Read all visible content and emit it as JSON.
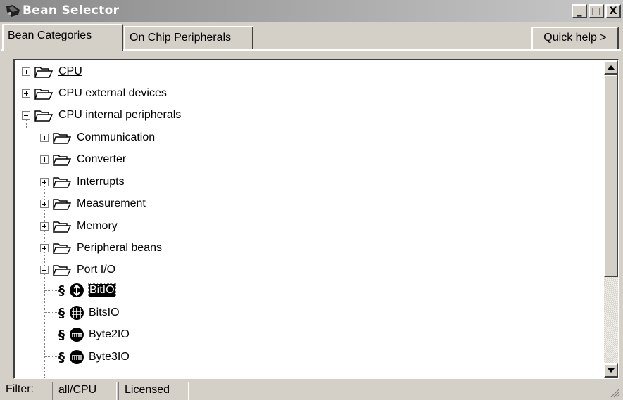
{
  "window": {
    "title": "Bean Selector",
    "minimize": "_",
    "maximize": "□",
    "close": "X"
  },
  "tabs": [
    {
      "label": "Bean Categories",
      "active": true
    },
    {
      "label": "On Chip Peripherals",
      "active": false
    }
  ],
  "quick_help": "Quick help >",
  "tree": [
    {
      "label": "CPU",
      "level": 0,
      "state": "collapsed",
      "underline": true
    },
    {
      "label": "CPU external devices",
      "level": 0,
      "state": "collapsed"
    },
    {
      "label": "CPU internal peripherals",
      "level": 0,
      "state": "expanded"
    },
    {
      "label": "Communication",
      "level": 1,
      "state": "collapsed"
    },
    {
      "label": "Converter",
      "level": 1,
      "state": "collapsed"
    },
    {
      "label": "Interrupts",
      "level": 1,
      "state": "collapsed"
    },
    {
      "label": "Measurement",
      "level": 1,
      "state": "collapsed"
    },
    {
      "label": "Memory",
      "level": 1,
      "state": "collapsed"
    },
    {
      "label": "Peripheral beans",
      "level": 1,
      "state": "collapsed"
    },
    {
      "label": "Port I/O",
      "level": 1,
      "state": "expanded"
    },
    {
      "label": "BitIO",
      "level": 2,
      "type": "bean",
      "selected": true,
      "prefix": "§",
      "icon": "bit-io-bean-icon"
    },
    {
      "label": "BitsIO",
      "level": 2,
      "type": "bean",
      "prefix": "§",
      "icon": "bits-io-bean-icon"
    },
    {
      "label": "Byte2IO",
      "level": 2,
      "type": "bean",
      "prefix": "§",
      "icon": "byte-io-bean-icon"
    },
    {
      "label": "Byte3IO",
      "level": 2,
      "type": "bean",
      "prefix": "§",
      "icon": "byte-io-bean-icon"
    }
  ],
  "status": {
    "filter_label": "Filter:",
    "filter_value": "all/CPU",
    "license": "Licensed"
  },
  "colors": {
    "title_bar_start": "#8a8a8a",
    "title_bar_end": "#c8c8c8",
    "face": "#d4d0c8",
    "selection": "#000000"
  }
}
